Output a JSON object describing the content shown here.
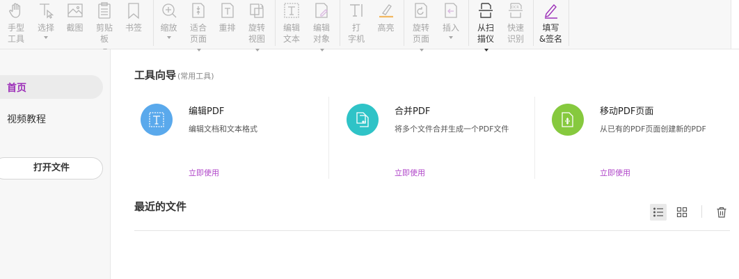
{
  "toolbar": {
    "tools": [
      {
        "key": "hand",
        "lines": [
          "手型",
          "工具"
        ],
        "icon": "hand-icon"
      },
      {
        "key": "select",
        "lines": [
          "选择"
        ],
        "icon": "select-cursor-icon",
        "dropdown": true
      },
      {
        "key": "screenshot",
        "lines": [
          "截图"
        ],
        "icon": "image-icon"
      },
      {
        "key": "clipboard",
        "lines": [
          "剪贴",
          "板"
        ],
        "icon": "clipboard-icon",
        "dropdown": true
      },
      {
        "key": "bookmark",
        "lines": [
          "书签"
        ],
        "icon": "bookmark-icon"
      },
      {
        "key": "zoom",
        "lines": [
          "缩放"
        ],
        "icon": "zoom-in-icon",
        "dropdown": true
      },
      {
        "key": "fit-page",
        "lines": [
          "适合",
          "页面"
        ],
        "icon": "fit-page-icon",
        "dropdown": true
      },
      {
        "key": "reflow",
        "lines": [
          "重排"
        ],
        "icon": "reflow-icon"
      },
      {
        "key": "rotate-view",
        "lines": [
          "旋转",
          "视图"
        ],
        "icon": "rotate-view-icon",
        "dropdown": true
      },
      {
        "key": "edit-text",
        "lines": [
          "编辑",
          "文本"
        ],
        "icon": "edit-text-icon"
      },
      {
        "key": "edit-object",
        "lines": [
          "编辑",
          "对象"
        ],
        "icon": "edit-object-icon",
        "dropdown": true
      },
      {
        "key": "typewriter",
        "lines": [
          "打",
          "字机"
        ],
        "icon": "typewriter-icon"
      },
      {
        "key": "highlight",
        "lines": [
          "高亮"
        ],
        "icon": "highlight-icon"
      },
      {
        "key": "rotate-page",
        "lines": [
          "旋转",
          "页面"
        ],
        "icon": "rotate-page-icon",
        "dropdown": true
      },
      {
        "key": "insert",
        "lines": [
          "插入"
        ],
        "icon": "insert-page-icon",
        "dropdown": true
      },
      {
        "key": "scan",
        "lines": [
          "从扫",
          "描仪"
        ],
        "icon": "scanner-icon",
        "dropdown": true
      },
      {
        "key": "ocr",
        "lines": [
          "快速",
          "识别"
        ],
        "icon": "ocr-icon"
      },
      {
        "key": "fill-sign",
        "lines": [
          "填写",
          "&签名"
        ],
        "icon": "fill-sign-pen-icon"
      }
    ]
  },
  "sidebar": {
    "home": "首页",
    "video": "视频教程",
    "open_file": "打开文件"
  },
  "guide": {
    "title": "工具向导",
    "subtitle": "(常用工具)",
    "cards": [
      {
        "title": "编辑PDF",
        "desc": "编辑文档和文本格式",
        "link": "立即使用",
        "color": "#5aa9ec",
        "icon": "edit-pdf-icon"
      },
      {
        "title": "合并PDF",
        "desc": "将多个文件合并生成一个PDF文件",
        "link": "立即使用",
        "color": "#2fc3c7",
        "icon": "merge-pdf-icon"
      },
      {
        "title": "移动PDF页面",
        "desc": "从已有的PDF页面创建新的PDF",
        "link": "立即使用",
        "color": "#86c93e",
        "icon": "move-pages-icon"
      }
    ]
  },
  "recent": {
    "title": "最近的文件"
  },
  "colors": {
    "accent": "#9c2fb8",
    "link": "#b046c9"
  }
}
